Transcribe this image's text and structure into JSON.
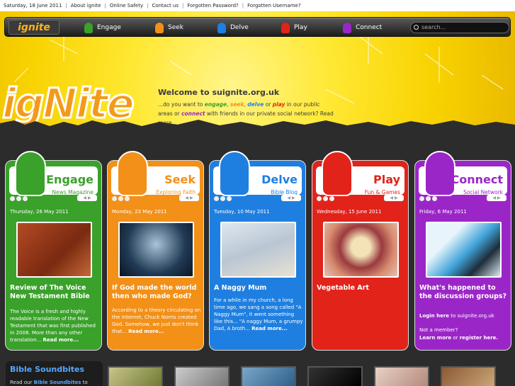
{
  "topbar": {
    "date": "Saturday, 18 June 2011",
    "links": [
      "About ignite",
      "Online Safety",
      "Contact us",
      "Forgotten Password?",
      "Forgotten Username?"
    ]
  },
  "nav": {
    "brand": "ignite",
    "items": [
      {
        "label": "Engage",
        "color": "#3aa12b"
      },
      {
        "label": "Seek",
        "color": "#f29018"
      },
      {
        "label": "Delve",
        "color": "#1f7fe0"
      },
      {
        "label": "Play",
        "color": "#e2231a"
      },
      {
        "label": "Connect",
        "color": "#9b26c8"
      }
    ],
    "search_placeholder": "search..."
  },
  "hero": {
    "logo": "igNite",
    "welcome": "Welcome to suignite.org.uk",
    "intro_prefix": "...do you want to ",
    "k1": "engage",
    "k2": "seek",
    "k3": "delve",
    "k4": "play",
    "intro_mid": " in our public areas or ",
    "k5": "connect",
    "intro_suffix": " with friends in our private social network? ",
    "read_more": "Read more..."
  },
  "cards": [
    {
      "title": "Engage",
      "subtitle": "News Magazine",
      "date": "Thursday, 26 May 2011",
      "article_title": "Review of The Voice New Testament Bible",
      "body": "The Voice is a fresh and highly readable translation of the New Testament that was first published in 2008. More than any other translation... ",
      "more": "Read more..."
    },
    {
      "title": "Seek",
      "subtitle": "Exploring Faith",
      "date": "Monday, 23 May 2011",
      "article_title": "If God made the world then who made God?",
      "body": "According to a theory circulating on the internet, Chuck Norris created God. Somehow, we just don't think that... ",
      "more": "Read more..."
    },
    {
      "title": "Delve",
      "subtitle": "Bible Blog",
      "date": "Tuesday, 10 May 2011",
      "article_title": "A Naggy Mum",
      "body": "For a while in my church, a long time ago, we sang a song called \"A Naggy Mum\", it went something like this... \"A naggy Mum, a grumpy Dad, A broth... ",
      "more": "Read more..."
    },
    {
      "title": "Play",
      "subtitle": "Fun & Games",
      "date": "Wednesday, 15 June 2011",
      "article_title": "Vegetable Art",
      "body": "",
      "more": ""
    },
    {
      "title": "Connect",
      "subtitle": "Social Network",
      "date": "Friday, 6 May 2011",
      "article_title": "What's happened to the discussion groups?",
      "login": "Login here",
      "login_suffix": " to suignite.org.uk",
      "not_member": "Not a member?",
      "learn": "Learn more",
      "or": " or ",
      "register": "register here."
    }
  ],
  "soundbites": {
    "title": "Bible Soundbites",
    "desc_prefix": "Read our ",
    "desc_link": "Bible Soundbites",
    "desc_suffix": " to"
  }
}
